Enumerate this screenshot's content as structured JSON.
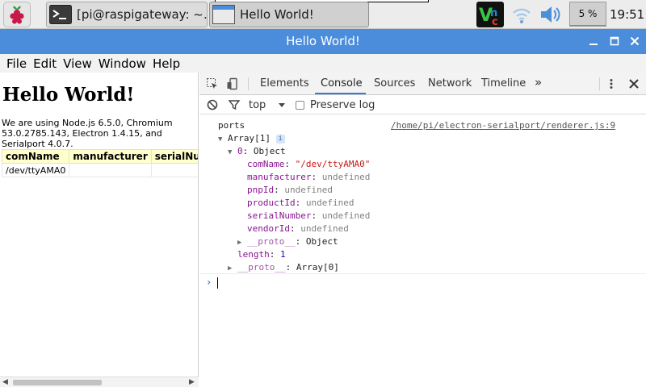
{
  "taskbar": {
    "tasks": [
      {
        "label": "[pi@raspigateway: ~…",
        "icon": "terminal-icon"
      },
      {
        "label": "Hello World!",
        "icon": "window-icon"
      }
    ],
    "cpu_text": "5 %",
    "cpu_level": 0.05,
    "clock": "19:51"
  },
  "window": {
    "title": "Hello World!"
  },
  "menubar": [
    "File",
    "Edit",
    "View",
    "Window",
    "Help"
  ],
  "page": {
    "heading": "Hello World!",
    "info": "We are using Node.js 6.5.0, Chromium 53.0.2785.143, Electron 1.4.15, and Serialport 4.0.7.",
    "table": {
      "headers": [
        "comName",
        "manufacturer",
        "serialNu"
      ],
      "rows": [
        [
          "/dev/ttyAMA0",
          "",
          ""
        ]
      ]
    }
  },
  "devtools": {
    "tabs": [
      "Elements",
      "Console",
      "Sources",
      "Network",
      "Timeline"
    ],
    "active_tab": "Console",
    "more": "»",
    "filter": {
      "context": "top",
      "preserve_log": "Preserve log"
    },
    "console": {
      "label": "ports",
      "source": "/home/pi/electron-serialport/renderer.js:9",
      "array_label": "Array[1]",
      "info_badge": "i",
      "index": "0",
      "object_label": "Object",
      "props": [
        {
          "key": "comName",
          "value": "\"/dev/ttyAMA0\""
        },
        {
          "key": "manufacturer",
          "value": "undefined"
        },
        {
          "key": "pnpId",
          "value": "undefined"
        },
        {
          "key": "productId",
          "value": "undefined"
        },
        {
          "key": "serialNumber",
          "value": "undefined"
        },
        {
          "key": "vendorId",
          "value": "undefined"
        }
      ],
      "proto_key": "__proto__",
      "proto_obj": "Object",
      "length_key": "length",
      "length_val": "1",
      "proto_arr": "Array[0]",
      "prompt": "›"
    }
  }
}
